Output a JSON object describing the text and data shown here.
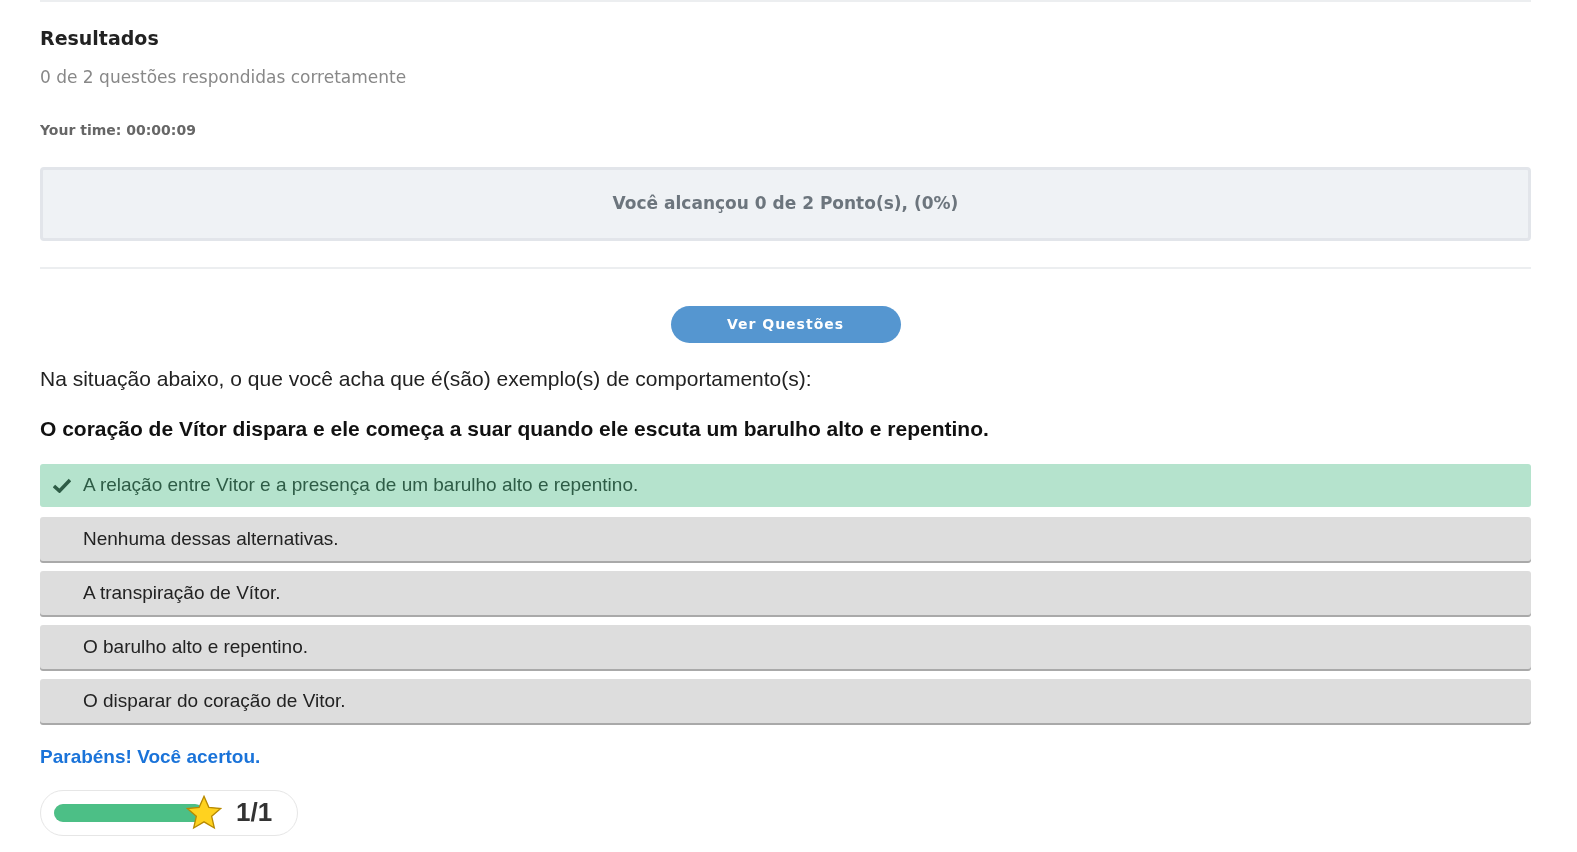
{
  "results": {
    "title": "Resultados",
    "summary": "0 de 2 questões respondidas corretamente",
    "time": "Your time: 00:00:09",
    "score_text": "Você alcançou 0 de 2 Ponto(s), (0%)"
  },
  "view_button": "Ver Questões",
  "question": {
    "prompt": "Na situação abaixo, o que você acha que é(são) exemplo(s) de comportamento(s):",
    "statement": "O coração de Vítor dispara e ele começa a suar quando ele escuta um barulho alto e repentino.",
    "answers": [
      {
        "text": "A relação entre Vitor e a presença de um barulho alto e repentino.",
        "correct": true
      },
      {
        "text": "Nenhuma dessas alternativas.",
        "correct": false
      },
      {
        "text": "A transpiração de Vítor.",
        "correct": false
      },
      {
        "text": "O barulho alto e repentino.",
        "correct": false
      },
      {
        "text": "O disparar do coração de Vitor.",
        "correct": false
      }
    ]
  },
  "feedback": "Parabéns! Você acertou.",
  "progress": {
    "level": 1,
    "score": "1/1"
  }
}
